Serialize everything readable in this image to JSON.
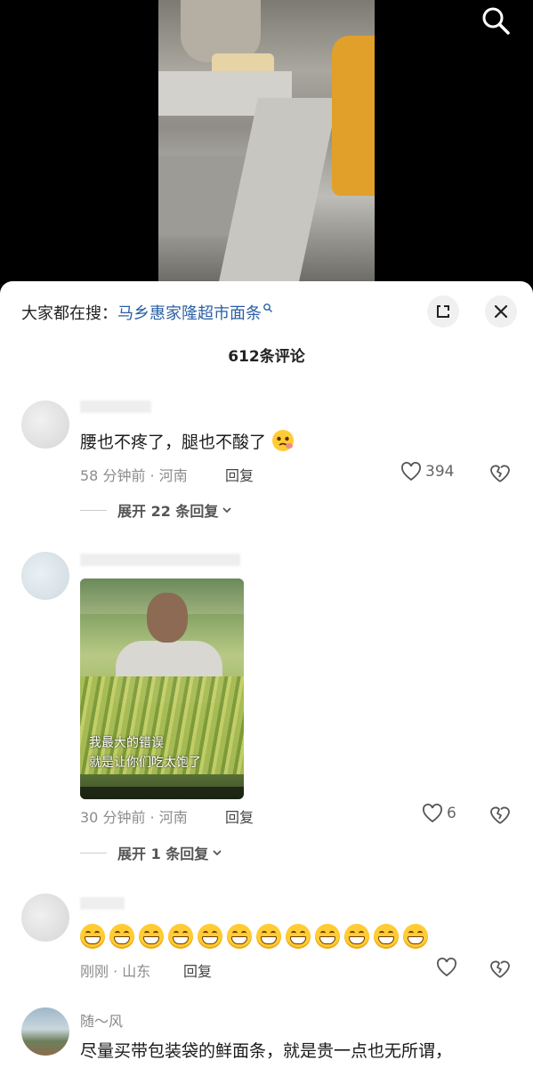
{
  "hot_search": {
    "prefix": "大家都在搜：",
    "keyword": "马乡惠家隆超市面条"
  },
  "comments_count": "612条评论",
  "comments": [
    {
      "username": "",
      "text": "腰也不疼了，腿也不酸了",
      "emoji": "pleading-face",
      "time_location": "58 分钟前 · 河南",
      "reply_label": "回复",
      "likes": "394",
      "expand_label": "展开 22 条回复"
    },
    {
      "username": "",
      "image_caption_1": "我最大的错误",
      "image_caption_2": "就是让你们吃太饱了",
      "time_location": "30 分钟前 · 河南",
      "reply_label": "回复",
      "likes": "6",
      "expand_label": "展开 1 条回复"
    },
    {
      "username": "",
      "emoji_count": 12,
      "emoji": "grinning-face",
      "time_location": "刚刚 · 山东",
      "reply_label": "回复",
      "likes": ""
    },
    {
      "username": "随～风",
      "text": "尽量买带包装袋的鲜面条，就是贵一点也无所谓，"
    }
  ],
  "colors": {
    "keyword_link": "#2b5fa6",
    "background_video": "#000000",
    "sheet": "#ffffff"
  },
  "icons": [
    "search-icon",
    "collapse-icon",
    "close-icon",
    "heart-icon",
    "broken-heart-icon",
    "chevron-down-icon"
  ]
}
